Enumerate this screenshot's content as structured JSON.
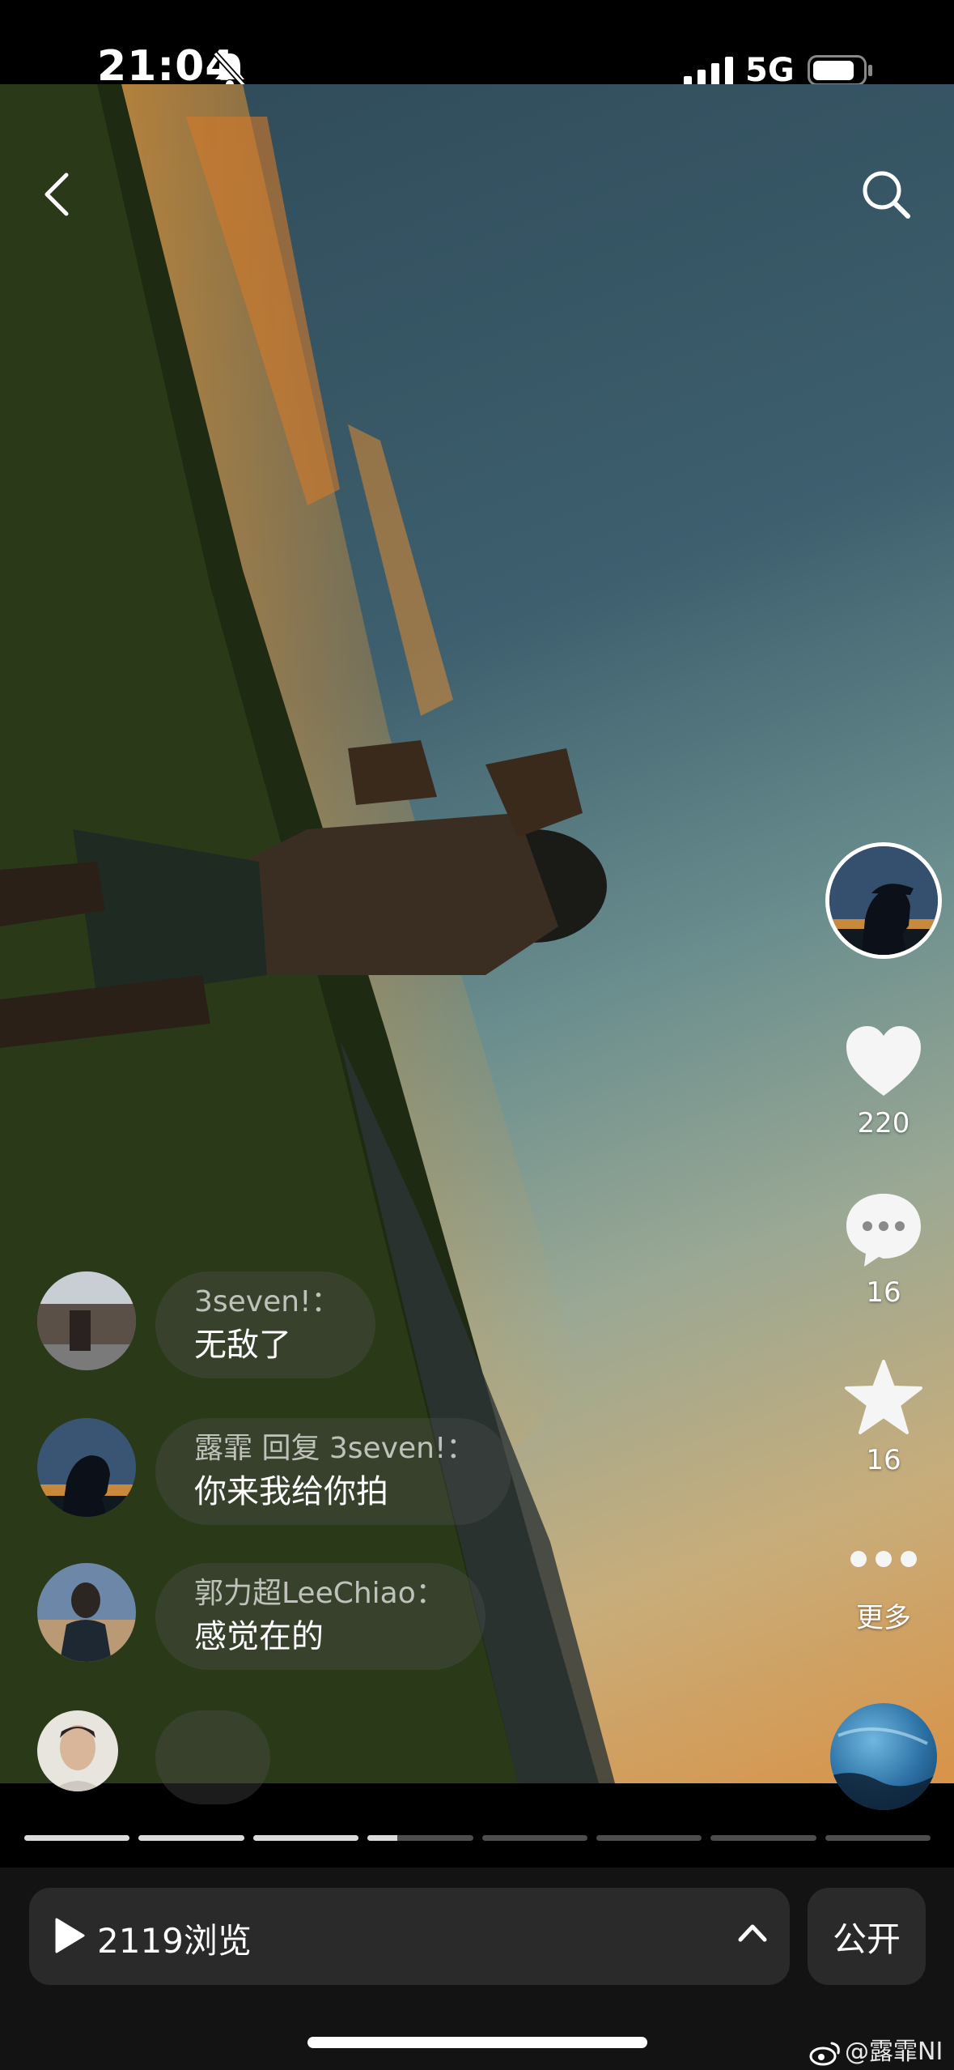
{
  "status_bar": {
    "time": "21:04",
    "network": "5G",
    "icons": [
      "bell-slash-icon",
      "signal-icon",
      "battery-icon"
    ]
  },
  "header": {
    "icons": [
      "chevron-left-icon",
      "search-icon"
    ]
  },
  "actions": {
    "likes": "220",
    "comments": "16",
    "favorites": "16",
    "more_label": "更多",
    "icons": [
      "heart-icon",
      "comment-bubble-icon",
      "star-icon",
      "ellipsis-icon"
    ]
  },
  "comments": [
    {
      "user": "3seven!：",
      "text": "无敌了"
    },
    {
      "user": "露霏 回复 3seven!：",
      "text": "你来我给你拍"
    },
    {
      "user": "郭力超LeeChiao：",
      "text": "感觉在的"
    },
    {
      "user": "",
      "text": ""
    }
  ],
  "progress": {
    "segments": 8,
    "current_index": 3,
    "current_fraction": 0.28
  },
  "footer": {
    "views_label": "2119浏览",
    "public_button": "公开"
  },
  "watermark": "@露霏NI",
  "colors": {
    "background": "#000000",
    "bar": "#2a2a2a",
    "text": "#ffffff"
  }
}
